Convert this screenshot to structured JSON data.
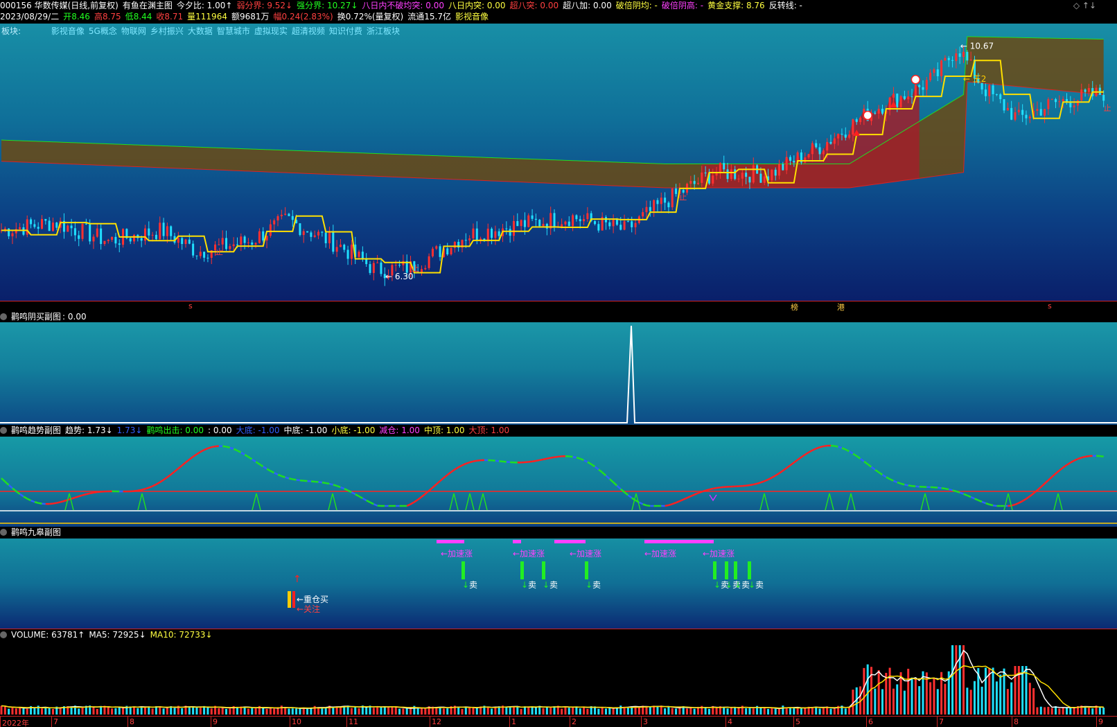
{
  "main_header": {
    "line1": [
      {
        "text": "000156 华数传媒(日线,前复权)",
        "color": "#ffffff"
      },
      {
        "text": "有鱼在渊主图",
        "color": "#ffffff"
      },
      {
        "text": "今夕比: 1.00↑",
        "color": "#ffffff"
      },
      {
        "text": "弱分界: 9.52↓",
        "color": "#ff4040"
      },
      {
        "text": "强分界: 10.27↓",
        "color": "#20ff20"
      },
      {
        "text": "八日内不破均突: 0.00",
        "color": "#ff40ff"
      },
      {
        "text": "八日内突: 0.00",
        "color": "#ffff40"
      },
      {
        "text": "超八突: 0.00",
        "color": "#ff4040"
      },
      {
        "text": "超八加: 0.00",
        "color": "#ffffff"
      },
      {
        "text": "破倍阴均: -",
        "color": "#ffff40"
      },
      {
        "text": "破倍阴高: -",
        "color": "#ff40ff"
      },
      {
        "text": "黄金支撑: 8.76",
        "color": "#ffff40"
      },
      {
        "text": "反转线: -",
        "color": "#ffffff"
      }
    ],
    "line2": [
      {
        "text": "2023/08/29/二",
        "color": "#ffffff"
      },
      {
        "text": "开8.46",
        "color": "#20ff20"
      },
      {
        "text": "高8.75",
        "color": "#ff4040"
      },
      {
        "text": "低8.44",
        "color": "#20ff20"
      },
      {
        "text": "收8.71",
        "color": "#ff4040"
      },
      {
        "text": "量111964",
        "color": "#ffff40"
      },
      {
        "text": "额9681万",
        "color": "#ffffff"
      },
      {
        "text": "幅0.24(2.83%)",
        "color": "#ff4040"
      },
      {
        "text": "换0.72%(量复权)",
        "color": "#ffffff"
      },
      {
        "text": "流通15.7亿",
        "color": "#ffffff"
      },
      {
        "text": "影视音像",
        "color": "#ffff40"
      }
    ],
    "window_controls": "◇ ↑↓"
  },
  "sector_bar": {
    "label": "板块:",
    "items": [
      "影视音像",
      "5G概念",
      "物联网",
      "乡村振兴",
      "大数据",
      "智慧城市",
      "虚拟现实",
      "超清视频",
      "知识付费",
      "浙江板块"
    ]
  },
  "main_chart": {
    "high_label": "10.67",
    "low_label": "6.30",
    "wang2_label": "王2",
    "zhi_label": "止",
    "bottom_marks": [
      {
        "text": "s",
        "color": "#ff4040"
      },
      {
        "text": "榜",
        "color": "#ffcc44"
      },
      {
        "text": "港",
        "color": "#ffcc44"
      },
      {
        "text": "s",
        "color": "#ff4040"
      }
    ]
  },
  "pane_yinmai": {
    "title": "鹳鸣阴买副图",
    "value": ": 0.00"
  },
  "pane_trend": {
    "items": [
      {
        "text": "鹳鸣趋势副图",
        "color": "#ffffff"
      },
      {
        "text": "趋势: 1.73↓",
        "color": "#ffffff"
      },
      {
        "text": "1.73↓",
        "color": "#3060ff"
      },
      {
        "text": "鹳鸣出击: 0.00",
        "color": "#20ff20"
      },
      {
        "text": ": 0.00",
        "color": "#ffffff"
      },
      {
        "text": "大底: -1.00",
        "color": "#3060ff"
      },
      {
        "text": "中底: -1.00",
        "color": "#ffffff"
      },
      {
        "text": "小底: -1.00",
        "color": "#ffff40"
      },
      {
        "text": "减仓: 1.00",
        "color": "#ff40ff"
      },
      {
        "text": "中顶: 1.00",
        "color": "#ffff40"
      },
      {
        "text": "大顶: 1.00",
        "color": "#ff4040"
      }
    ]
  },
  "pane_jiugao": {
    "title": "鹳鸣九皋副图",
    "accel_label": "←加速涨",
    "sell_label": "卖",
    "heavy_buy": "←重仓买",
    "watch": "←关注"
  },
  "pane_volume": {
    "items": [
      {
        "text": "VOLUME: 63781↑",
        "color": "#ffffff"
      },
      {
        "text": "MA5: 72925↓",
        "color": "#ffffff"
      },
      {
        "text": "MA10: 72733↓",
        "color": "#ffff40"
      }
    ]
  },
  "time_axis": {
    "labels": [
      "2022年",
      "7",
      "8",
      "9",
      "10",
      "11",
      "12",
      "1",
      "2",
      "3",
      "4",
      "5",
      "6",
      "7",
      "8",
      "9"
    ]
  },
  "chart_data": {
    "type": "candlestick",
    "symbol": "000156 华数传媒",
    "period": "日线",
    "price_high": 10.67,
    "price_low": 6.3,
    "last_close": 8.71,
    "last_volume": 63781,
    "ma5": 72925,
    "ma10": 72733
  },
  "colors": {
    "up": "#ff3030",
    "down": "#20e0ff",
    "yellow_line": "#ffe000",
    "green": "#20ff20",
    "magenta": "#ff40ff"
  }
}
